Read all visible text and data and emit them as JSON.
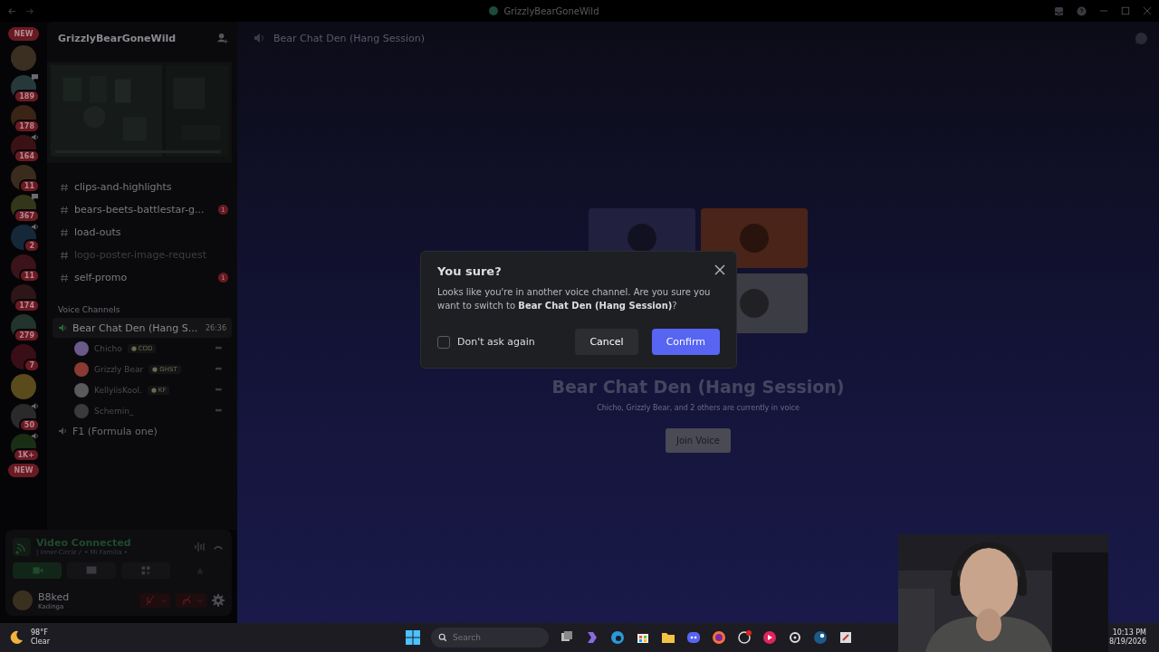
{
  "window": {
    "title": "GrizzlyBearGoneWild"
  },
  "servers": [
    {
      "kind": "pill",
      "label": "NEW"
    },
    {
      "kind": "icon",
      "color": "#3b2f22",
      "in_voice": false,
      "chat_active": false
    },
    {
      "kind": "icon",
      "color": "#26383a",
      "in_voice": false,
      "chat_active": true,
      "badge": "189"
    },
    {
      "kind": "icon",
      "color": "#3a2416",
      "in_voice": false,
      "chat_active": false,
      "badge": "178"
    },
    {
      "kind": "icon",
      "color": "#3a1216",
      "in_voice": true,
      "chat_active": false,
      "badge": "164"
    },
    {
      "kind": "icon",
      "color": "#3a2c1c",
      "in_voice": false,
      "chat_active": false,
      "badge": "11"
    },
    {
      "kind": "icon",
      "color": "#34361a",
      "in_voice": false,
      "chat_active": true,
      "badge": "367"
    },
    {
      "kind": "icon",
      "color": "#14283a",
      "in_voice": true,
      "chat_active": false,
      "badge": "2"
    },
    {
      "kind": "icon",
      "color": "#3a1418",
      "in_voice": false,
      "chat_active": false,
      "badge": "11"
    },
    {
      "kind": "icon",
      "color": "#2e1618",
      "in_voice": false,
      "chat_active": false,
      "badge": "174"
    },
    {
      "kind": "icon",
      "color": "#22342c",
      "in_voice": false,
      "chat_active": false,
      "badge": "279"
    },
    {
      "kind": "icon",
      "color": "#3a0e16",
      "in_voice": false,
      "chat_active": false,
      "badge": "7"
    },
    {
      "kind": "icon",
      "color": "#5a4a1c",
      "in_voice": false,
      "chat_active": false
    },
    {
      "kind": "icon",
      "color": "#2a2a2a",
      "in_voice": true,
      "chat_active": false,
      "badge": "50"
    },
    {
      "kind": "icon",
      "color": "#1a2e14",
      "in_voice": true,
      "chat_active": false,
      "badge": "1K+"
    },
    {
      "kind": "pill",
      "label": "NEW"
    }
  ],
  "server_name": "GrizzlyBearGoneWild",
  "text_channels": [
    {
      "name": "clips-and-highlights",
      "muted": false
    },
    {
      "name": "bears-beets-battlestar-g...",
      "muted": false,
      "badge": "1"
    },
    {
      "name": "load-outs",
      "muted": false
    },
    {
      "name": "logo-poster-image-request",
      "muted": true
    },
    {
      "name": "self-promo",
      "muted": false,
      "badge": "1"
    }
  ],
  "voice_category": "Voice Channels",
  "voice_channels": [
    {
      "name": "Bear Chat Den (Hang S...",
      "timer": "26:36",
      "selected": true,
      "members": [
        {
          "name": "Chicho",
          "tag": "COD",
          "color": "#6a5a8a"
        },
        {
          "name": "Grizzly Bear",
          "tag": "GHST",
          "color": "#8a3a30"
        },
        {
          "name": "KellyiisKool.",
          "tag": "KF",
          "color": "#5a5a5a"
        },
        {
          "name": "Schemin_",
          "color": "#3a3a3a"
        }
      ]
    },
    {
      "name": "F1 (Formula one)",
      "selected": false
    }
  ],
  "voice_panel": {
    "status": "Video Connected",
    "channel": "| Inner-Circle /",
    "server": "• Mi Familia •"
  },
  "user": {
    "name": "B8ked",
    "status": "Kadinga"
  },
  "header": {
    "channel": "Bear Chat Den (Hang Session)"
  },
  "stage": {
    "tiles": [
      {
        "color": "#22203f"
      },
      {
        "color": "#4a2418"
      },
      {
        "color": "#3c3c44"
      }
    ],
    "title": "Bear Chat Den (Hang Session)",
    "subtitle": "Chicho, Grizzly Bear, and 2 others are currently in voice",
    "button": "Join Voice"
  },
  "modal": {
    "title": "You sure?",
    "body": "Looks like you're in another voice channel. Are you sure you want to switch to **Bear Chat Den (Hang Session)**?",
    "dont_ask_again": {
      "label": "Don't ask again",
      "checked": false
    },
    "cancel": "Cancel",
    "confirm": "Confirm"
  },
  "taskbar": {
    "temperature": "98°F",
    "weather": "Clear",
    "search_placeholder": "Search",
    "time": "10:13 PM",
    "date": "8/19/2026"
  }
}
